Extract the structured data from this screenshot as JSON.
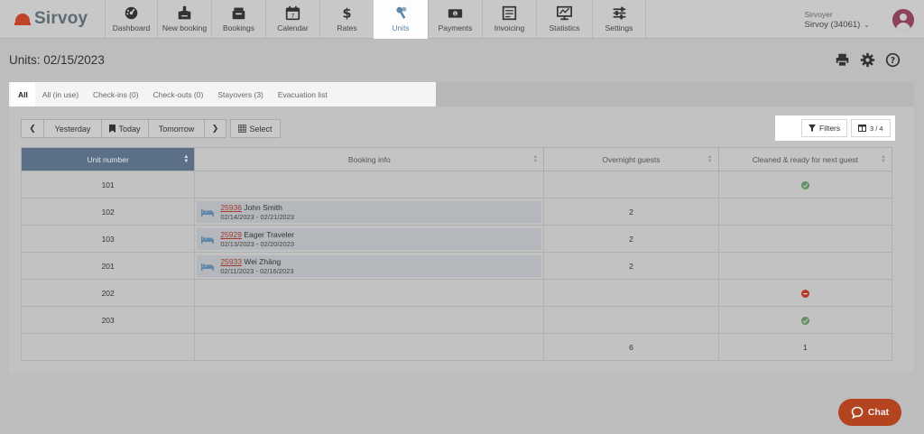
{
  "brand": {
    "name": "Sirvoy",
    "accent": "#c0442b"
  },
  "nav": [
    {
      "label": "Dashboard",
      "icon": "dashboard-icon",
      "active": false
    },
    {
      "label": "New booking",
      "icon": "new-booking-icon",
      "active": false
    },
    {
      "label": "Bookings",
      "icon": "bookings-icon",
      "active": false
    },
    {
      "label": "Calendar",
      "icon": "calendar-icon",
      "active": false
    },
    {
      "label": "Rates",
      "icon": "dollar-icon",
      "active": false
    },
    {
      "label": "Units",
      "icon": "keys-icon",
      "active": true
    },
    {
      "label": "Payments",
      "icon": "payments-icon",
      "active": false
    },
    {
      "label": "Invoicing",
      "icon": "invoicing-icon",
      "active": false
    },
    {
      "label": "Statistics",
      "icon": "statistics-icon",
      "active": false
    },
    {
      "label": "Settings",
      "icon": "sliders-icon",
      "active": false
    }
  ],
  "user": {
    "org": "Sirvoyer",
    "account": "Sirvoy (34061)"
  },
  "page": {
    "title": "Units: 02/15/2023"
  },
  "tabs": [
    {
      "label": "All",
      "active": true
    },
    {
      "label": "All (in use)",
      "active": false
    },
    {
      "label": "Check-ins (0)",
      "active": false
    },
    {
      "label": "Check-outs (0)",
      "active": false
    },
    {
      "label": "Stayovers (3)",
      "active": false
    },
    {
      "label": "Evacuation list",
      "active": false
    }
  ],
  "toolbar": {
    "yesterday": "Yesterday",
    "today": "Today",
    "tomorrow": "Tomorrow",
    "select": "Select",
    "filters": "Filters",
    "columns": "3 / 4"
  },
  "table": {
    "headers": [
      "Unit number",
      "Booking info",
      "Overnight guests",
      "Cleaned & ready for next guest"
    ],
    "rows": [
      {
        "unit": "101",
        "booking": null,
        "guests": "",
        "cleaned": "ok"
      },
      {
        "unit": "102",
        "booking": {
          "id": "25936",
          "name": "John Smith",
          "dates": "02/14/2023 - 02/21/2023"
        },
        "guests": "2",
        "cleaned": ""
      },
      {
        "unit": "103",
        "booking": {
          "id": "25929",
          "name": "Eager Traveler",
          "dates": "02/13/2023 - 02/20/2023"
        },
        "guests": "2",
        "cleaned": ""
      },
      {
        "unit": "201",
        "booking": {
          "id": "25933",
          "name": "Wei Zhāng",
          "dates": "02/11/2023 - 02/16/2023"
        },
        "guests": "2",
        "cleaned": ""
      },
      {
        "unit": "202",
        "booking": null,
        "guests": "",
        "cleaned": "bad"
      },
      {
        "unit": "203",
        "booking": null,
        "guests": "",
        "cleaned": "ok"
      }
    ],
    "totals": {
      "unit": "",
      "booking": "",
      "guests": "6",
      "cleaned": "1"
    }
  },
  "chat": {
    "label": "Chat"
  },
  "colors": {
    "ok": "#5f8f5e",
    "bad": "#b63a2a",
    "booking_id": "#a33a2c",
    "header_sorted": "#5b7086"
  }
}
